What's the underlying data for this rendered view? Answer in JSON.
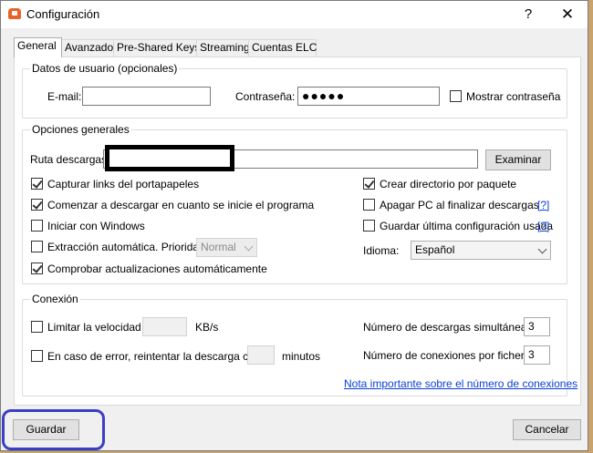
{
  "window": {
    "title": "Configuración",
    "help_glyph": "?",
    "close_glyph": "✕"
  },
  "tabs": [
    "General",
    "Avanzado",
    "Pre-Shared Keys",
    "Streaming",
    "Cuentas ELC"
  ],
  "user": {
    "legend": "Datos de usuario (opcionales)",
    "email_label": "E-mail:",
    "email_value": "",
    "password_label": "Contraseña:",
    "password_value": "●●●●●",
    "show_password_label": "Mostrar contraseña"
  },
  "general": {
    "legend": "Opciones generales",
    "download_path_label": "Ruta descargas:",
    "download_path_value": "",
    "browse_label": "Examinar",
    "capture_links": "Capturar links del portapapeles",
    "start_download": "Comenzar a descargar en cuanto se inicie el programa",
    "start_windows": "Iniciar con Windows",
    "auto_extract": "Extracción automática. Prioridad:",
    "priority_value": "Normal",
    "check_updates": "Comprobar actualizaciones automáticamente",
    "create_dir": "Crear directorio por paquete",
    "shutdown_pc": "Apagar PC al finalizar descargas",
    "save_last_config": "Guardar última configuración usada",
    "help_link": "[?]",
    "language_label": "Idioma:",
    "language_value": "Español"
  },
  "connection": {
    "legend": "Conexión",
    "limit_speed": "Limitar la velocidad a",
    "speed_unit": "KB/s",
    "retry_error": "En caso de error, reintentar la descarga cada",
    "retry_unit": "minutos",
    "simultaneous_label": "Número de descargas simultáneas:",
    "simultaneous_value": "3",
    "per_file_label": "Número de conexiones por fichero:",
    "per_file_value": "3",
    "note_link": "Nota importante sobre el número de conexiones"
  },
  "footer": {
    "save_label": "Guardar",
    "cancel_label": "Cancelar"
  }
}
